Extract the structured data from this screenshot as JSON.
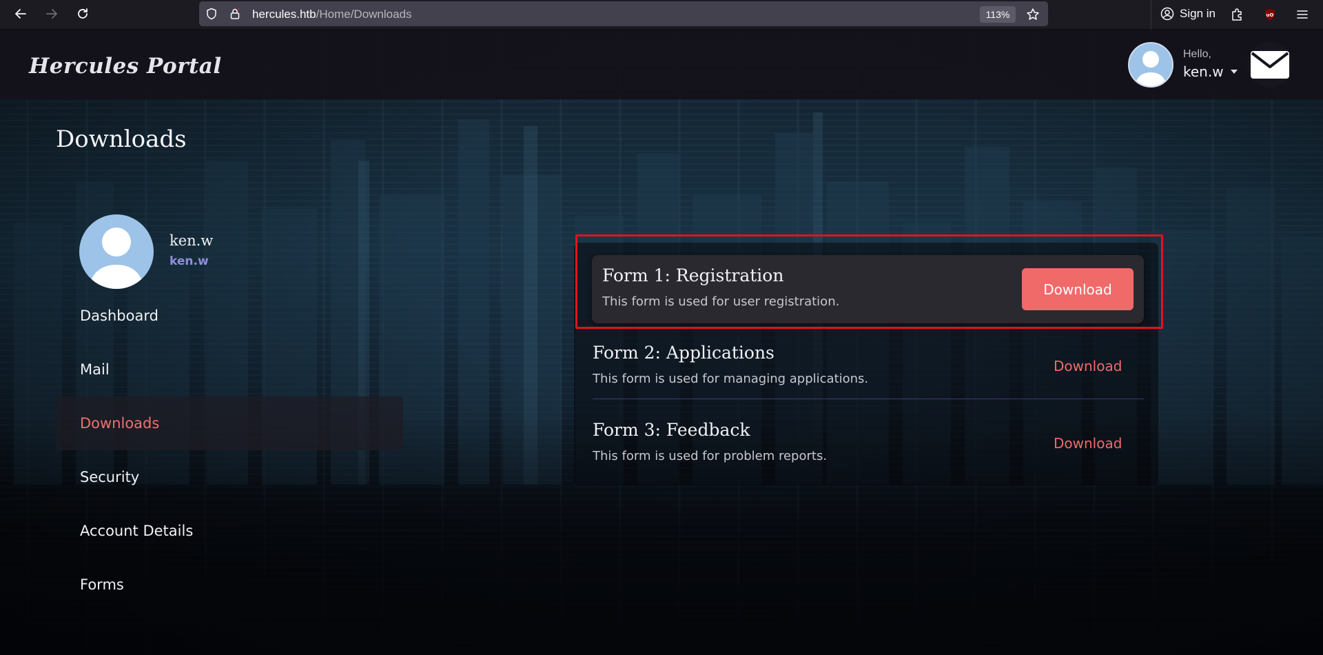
{
  "browser": {
    "url_host": "hercules.htb",
    "url_path": "/Home/Downloads",
    "zoom": "113%",
    "signin_label": "Sign in"
  },
  "header": {
    "brand": "Hercules Portal",
    "greeting": "Hello,",
    "username": "ken.w"
  },
  "page": {
    "title": "Downloads"
  },
  "sidebar": {
    "profile_name": "ken.w",
    "profile_handle": "ken.w",
    "items": [
      {
        "label": "Dashboard"
      },
      {
        "label": "Mail"
      },
      {
        "label": "Downloads",
        "active": true
      },
      {
        "label": "Security"
      },
      {
        "label": "Account Details"
      },
      {
        "label": "Forms"
      }
    ]
  },
  "forms": [
    {
      "title": "Form 1: Registration",
      "description": "This form is used for user registration.",
      "action": "Download"
    },
    {
      "title": "Form 2: Applications",
      "description": "This form is used for managing applications.",
      "action": "Download"
    },
    {
      "title": "Form 3: Feedback",
      "description": "This form is used for problem reports.",
      "action": "Download"
    }
  ],
  "colors": {
    "accent": "#f16a6a",
    "highlight": "#e0141e",
    "handle": "#8f8fd9"
  }
}
